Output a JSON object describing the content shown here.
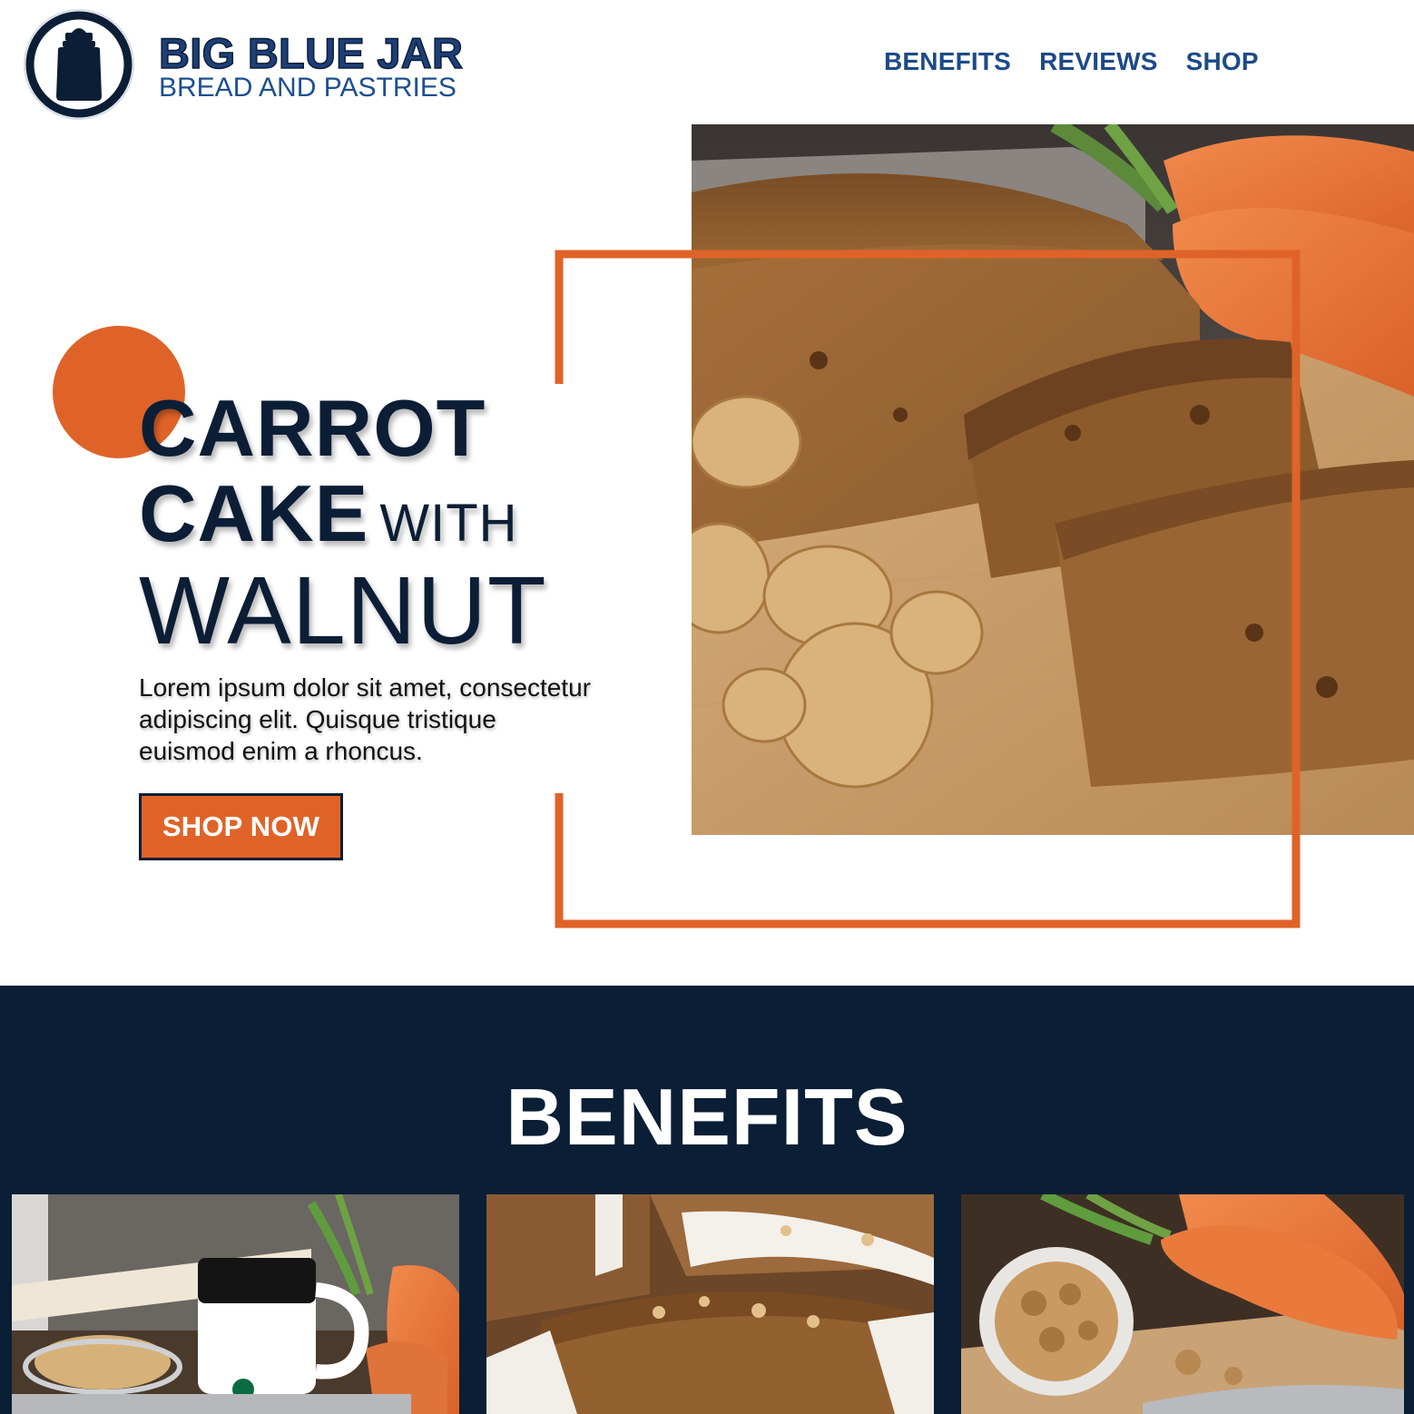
{
  "header": {
    "brand_name": "BIG BLUE JAR",
    "brand_tagline": "BREAD AND PASTRIES",
    "logo_icon": "jar-icon",
    "nav": [
      {
        "label": "BENEFITS"
      },
      {
        "label": "REVIEWS"
      },
      {
        "label": "SHOP"
      }
    ]
  },
  "hero": {
    "title_line1": "CARROT",
    "title_line2": "CAKE",
    "title_line2_small": "WITH",
    "title_line3": "WALNUT",
    "description": "Lorem ipsum dolor sit amet, consectetur adipiscing elit. Quisque tristique euismod enim a rhoncus.",
    "cta_label": "SHOP NOW"
  },
  "benefits": {
    "heading": "BENEFITS"
  },
  "colors": {
    "navy": "#0a1e35",
    "brand_blue": "#1d4a88",
    "accent_orange": "#df6328",
    "white": "#ffffff"
  }
}
